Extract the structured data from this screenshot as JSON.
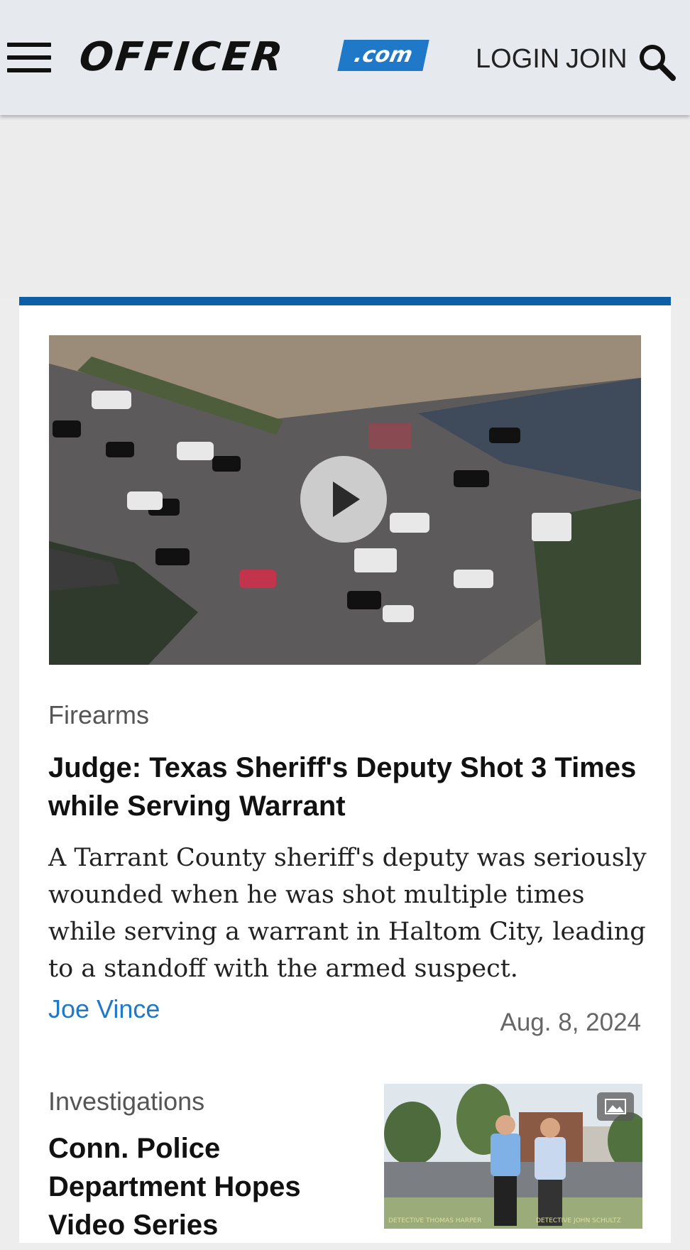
{
  "header": {
    "logo_text": "OFFICER",
    "logo_com": ".com",
    "login_label": "LOGIN",
    "join_label": "JOIN",
    "icons": {
      "menu": "hamburger-menu-icon",
      "search": "search-icon"
    }
  },
  "colors": {
    "accent": "#0d5fa8",
    "link": "#1f78c8",
    "header_bg": "#e6e9ee"
  },
  "featured": {
    "category": "Firearms",
    "title": "Judge: Texas Sheriff's Deputy Shot 3 Times while Serving Warrant",
    "summary": "A Tarrant County sheriff's deputy was seriously wounded when he was shot multiple times while serving a warrant in Haltom City, leading to a standoff with the armed suspect.",
    "author": "Joe Vince",
    "date": "Aug. 8, 2024",
    "media_icon": "play-icon"
  },
  "article2": {
    "category": "Investigations",
    "title": "Conn. Police Department Hopes Video Series Uncovers...",
    "thumb_caption_left": "DETECTIVE THOMAS HARPER",
    "thumb_caption_right": "DETECTIVE JOHN SCHULTZ",
    "media_icon": "gallery-icon"
  }
}
